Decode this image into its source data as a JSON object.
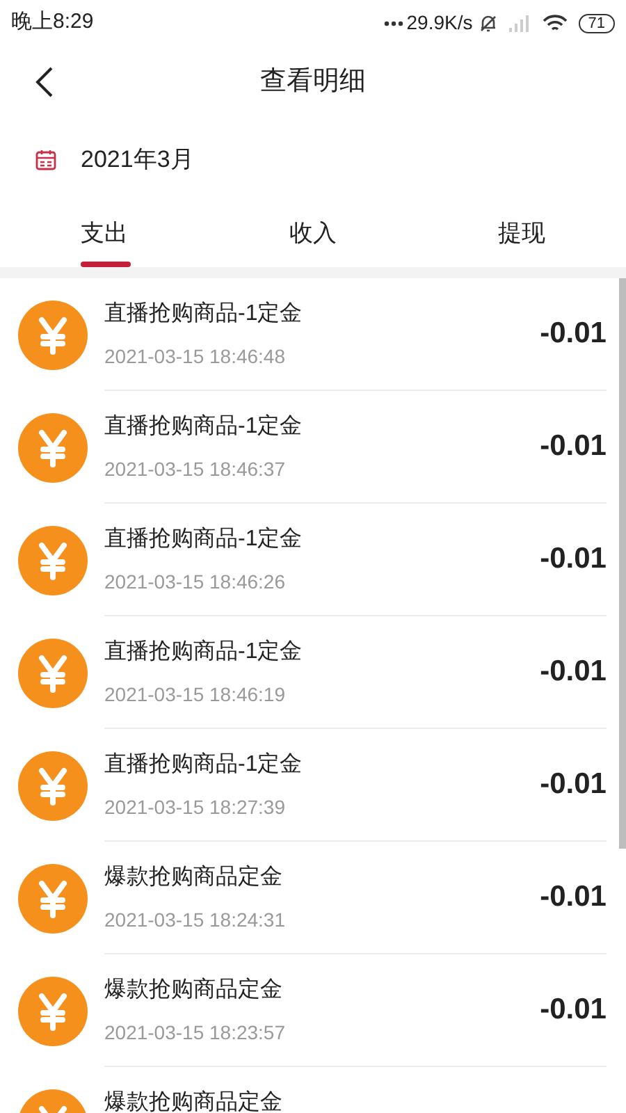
{
  "status_bar": {
    "time": "晚上8:29",
    "speed": "29.9K/s",
    "battery": "71"
  },
  "header": {
    "title": "查看明细"
  },
  "month": {
    "label": "2021年3月"
  },
  "tabs": [
    {
      "label": "支出",
      "selected": true
    },
    {
      "label": "收入",
      "selected": false
    },
    {
      "label": "提现",
      "selected": false
    }
  ],
  "records": [
    {
      "title": "直播抢购商品-1定金",
      "time": "2021-03-15 18:46:48",
      "amount": "-0.01"
    },
    {
      "title": "直播抢购商品-1定金",
      "time": "2021-03-15 18:46:37",
      "amount": "-0.01"
    },
    {
      "title": "直播抢购商品-1定金",
      "time": "2021-03-15 18:46:26",
      "amount": "-0.01"
    },
    {
      "title": "直播抢购商品-1定金",
      "time": "2021-03-15 18:46:19",
      "amount": "-0.01"
    },
    {
      "title": "直播抢购商品-1定金",
      "time": "2021-03-15 18:27:39",
      "amount": "-0.01"
    },
    {
      "title": "爆款抢购商品定金",
      "time": "2021-03-15 18:24:31",
      "amount": "-0.01"
    },
    {
      "title": "爆款抢购商品定金",
      "time": "2021-03-15 18:23:57",
      "amount": "-0.01"
    },
    {
      "title": "爆款抢购商品定金"
    }
  ]
}
